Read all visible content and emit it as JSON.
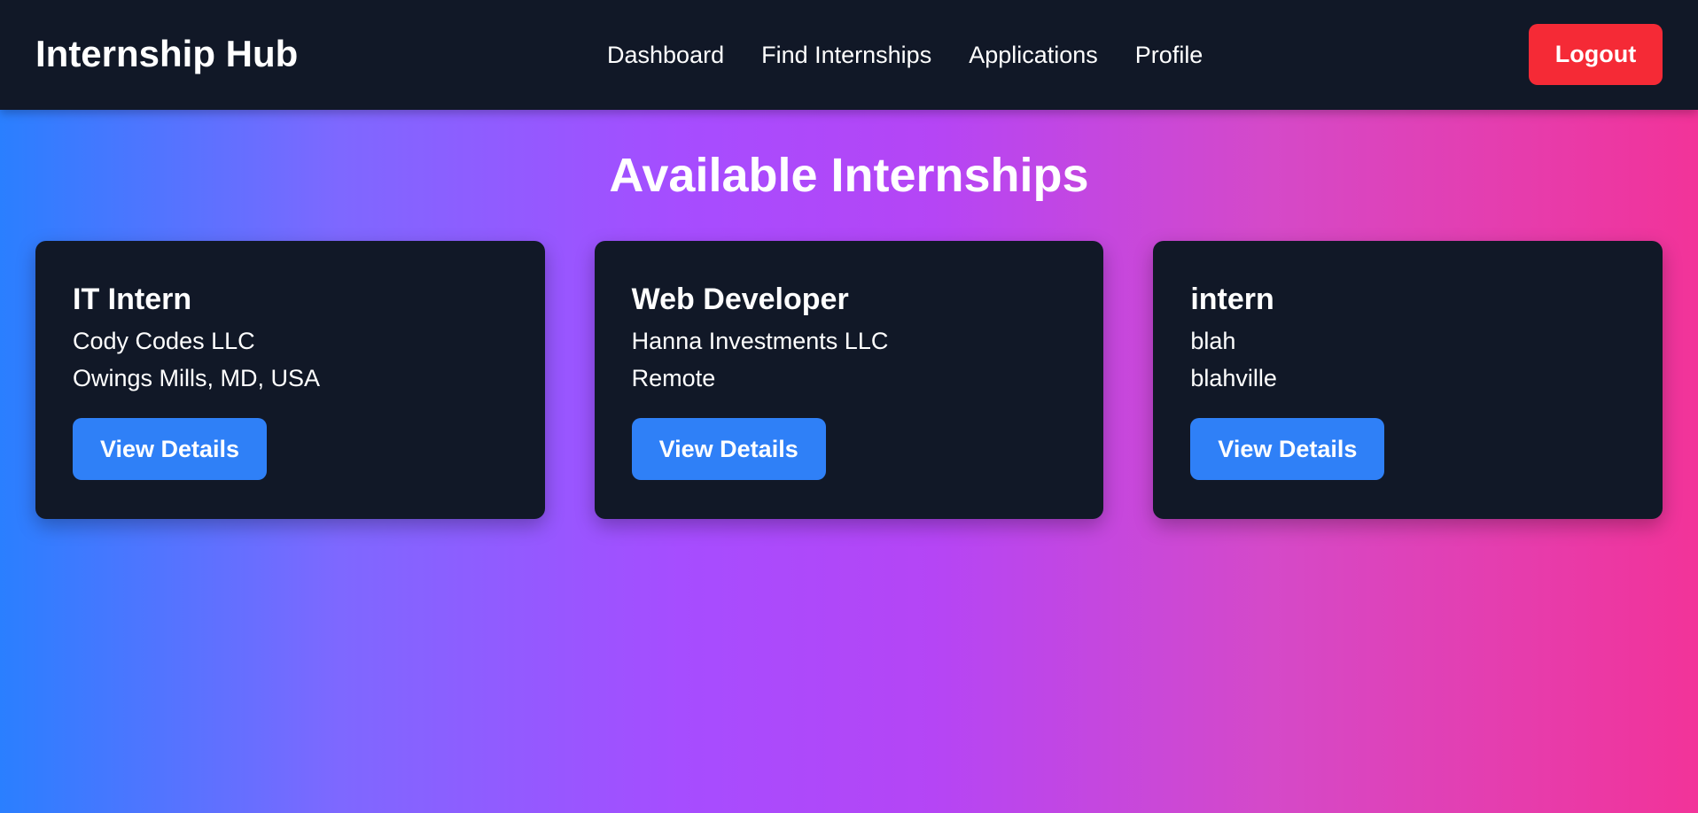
{
  "navbar": {
    "brand": "Internship Hub",
    "links": [
      "Dashboard",
      "Find Internships",
      "Applications",
      "Profile"
    ],
    "logout_label": "Logout"
  },
  "page": {
    "title": "Available Internships"
  },
  "internships": [
    {
      "title": "IT Intern",
      "company": "Cody Codes LLC",
      "location": "Owings Mills, MD, USA",
      "button": "View Details"
    },
    {
      "title": "Web Developer",
      "company": "Hanna Investments LLC",
      "location": "Remote",
      "button": "View Details"
    },
    {
      "title": "intern",
      "company": "blah",
      "location": "blahville",
      "button": "View Details"
    }
  ],
  "colors": {
    "navbar_bg": "#111827",
    "card_bg": "#111827",
    "primary_button": "#2f80f7",
    "logout_button": "#f52a36",
    "gradient_start": "#2a7fff",
    "gradient_mid": "#b545f5",
    "gradient_end": "#f23399"
  }
}
